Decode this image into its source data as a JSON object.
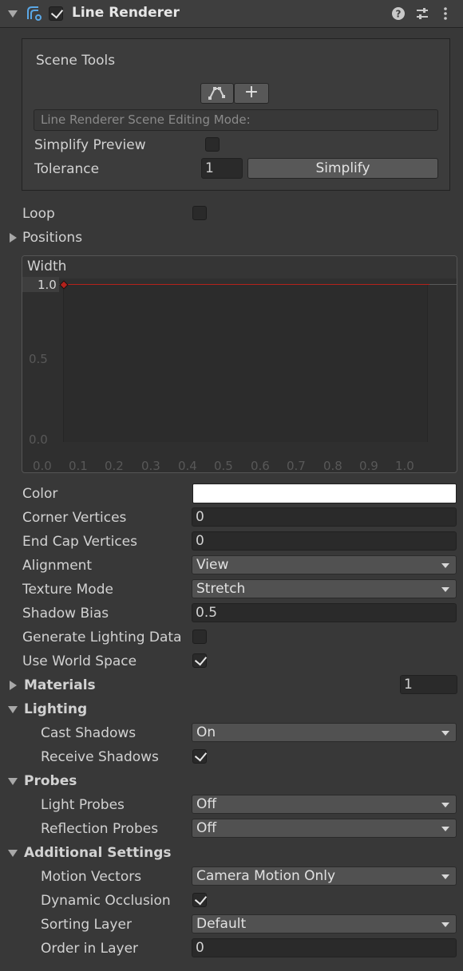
{
  "header": {
    "title": "Line Renderer",
    "enabled": true
  },
  "scene_tools": {
    "title": "Scene Tools",
    "mode_text": "Line Renderer Scene Editing Mode:",
    "simplify_preview_label": "Simplify Preview",
    "tolerance_label": "Tolerance",
    "tolerance_value": "1",
    "simplify_button": "Simplify",
    "add_button": "+"
  },
  "loop_label": "Loop",
  "positions_label": "Positions",
  "width_curve": {
    "title": "Width",
    "key_value": "1.0",
    "y_ticks": [
      "0.5",
      "0.0"
    ],
    "x_ticks": [
      "0.0",
      "0.1",
      "0.2",
      "0.3",
      "0.4",
      "0.5",
      "0.6",
      "0.7",
      "0.8",
      "0.9",
      "1.0"
    ]
  },
  "properties": {
    "color_label": "Color",
    "color_value": "#ffffff",
    "corner_vertices_label": "Corner Vertices",
    "corner_vertices_value": "0",
    "end_cap_vertices_label": "End Cap Vertices",
    "end_cap_vertices_value": "0",
    "alignment_label": "Alignment",
    "alignment_value": "View",
    "texture_mode_label": "Texture Mode",
    "texture_mode_value": "Stretch",
    "shadow_bias_label": "Shadow Bias",
    "shadow_bias_value": "0.5",
    "generate_lighting_label": "Generate Lighting Data",
    "use_world_space_label": "Use World Space"
  },
  "materials": {
    "label": "Materials",
    "count": "1"
  },
  "lighting": {
    "label": "Lighting",
    "cast_shadows_label": "Cast Shadows",
    "cast_shadows_value": "On",
    "receive_shadows_label": "Receive Shadows"
  },
  "probes": {
    "label": "Probes",
    "light_probes_label": "Light Probes",
    "light_probes_value": "Off",
    "reflection_probes_label": "Reflection Probes",
    "reflection_probes_value": "Off"
  },
  "additional": {
    "label": "Additional Settings",
    "motion_vectors_label": "Motion Vectors",
    "motion_vectors_value": "Camera Motion Only",
    "dynamic_occlusion_label": "Dynamic Occlusion",
    "sorting_layer_label": "Sorting Layer",
    "sorting_layer_value": "Default",
    "order_in_layer_label": "Order in Layer",
    "order_in_layer_value": "0"
  }
}
